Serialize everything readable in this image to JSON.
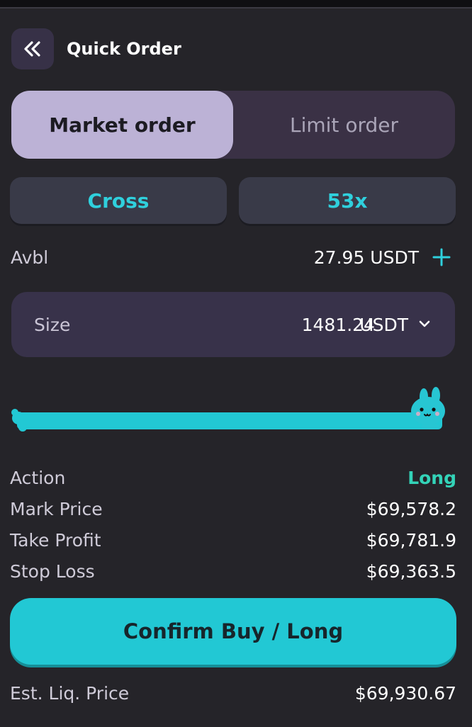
{
  "header": {
    "title": "Quick Order",
    "back_icon": "double-chevron-left-icon"
  },
  "order_tabs": [
    {
      "label": "Market order",
      "active": true
    },
    {
      "label": "Limit order",
      "active": false
    }
  ],
  "margin_mode": "Cross",
  "leverage": "53x",
  "available": {
    "label": "Avbl",
    "value": "27.95 USDT",
    "add_icon": "plus-icon"
  },
  "size": {
    "label": "Size",
    "value": "1481.24",
    "unit": "USDT",
    "dropdown_icon": "chevron-down-icon"
  },
  "slider": {
    "level_percent": 100,
    "handle_icon": "bunny-icon"
  },
  "details": [
    {
      "label": "Action",
      "value": "Long"
    },
    {
      "label": "Mark Price",
      "value": "$69,578.2"
    },
    {
      "label": "Take Profit",
      "value": "$69,781.9"
    },
    {
      "label": "Stop Loss",
      "value": "$69,363.5"
    }
  ],
  "confirm_label": "Confirm Buy / Long",
  "liquidation": {
    "label": "Est. Liq. Price",
    "value": "$69,930.67"
  },
  "colors": {
    "accent": "#22c8d4",
    "long": "#33d3b8",
    "background": "#252429",
    "active_tab": "#bcb2d6"
  }
}
